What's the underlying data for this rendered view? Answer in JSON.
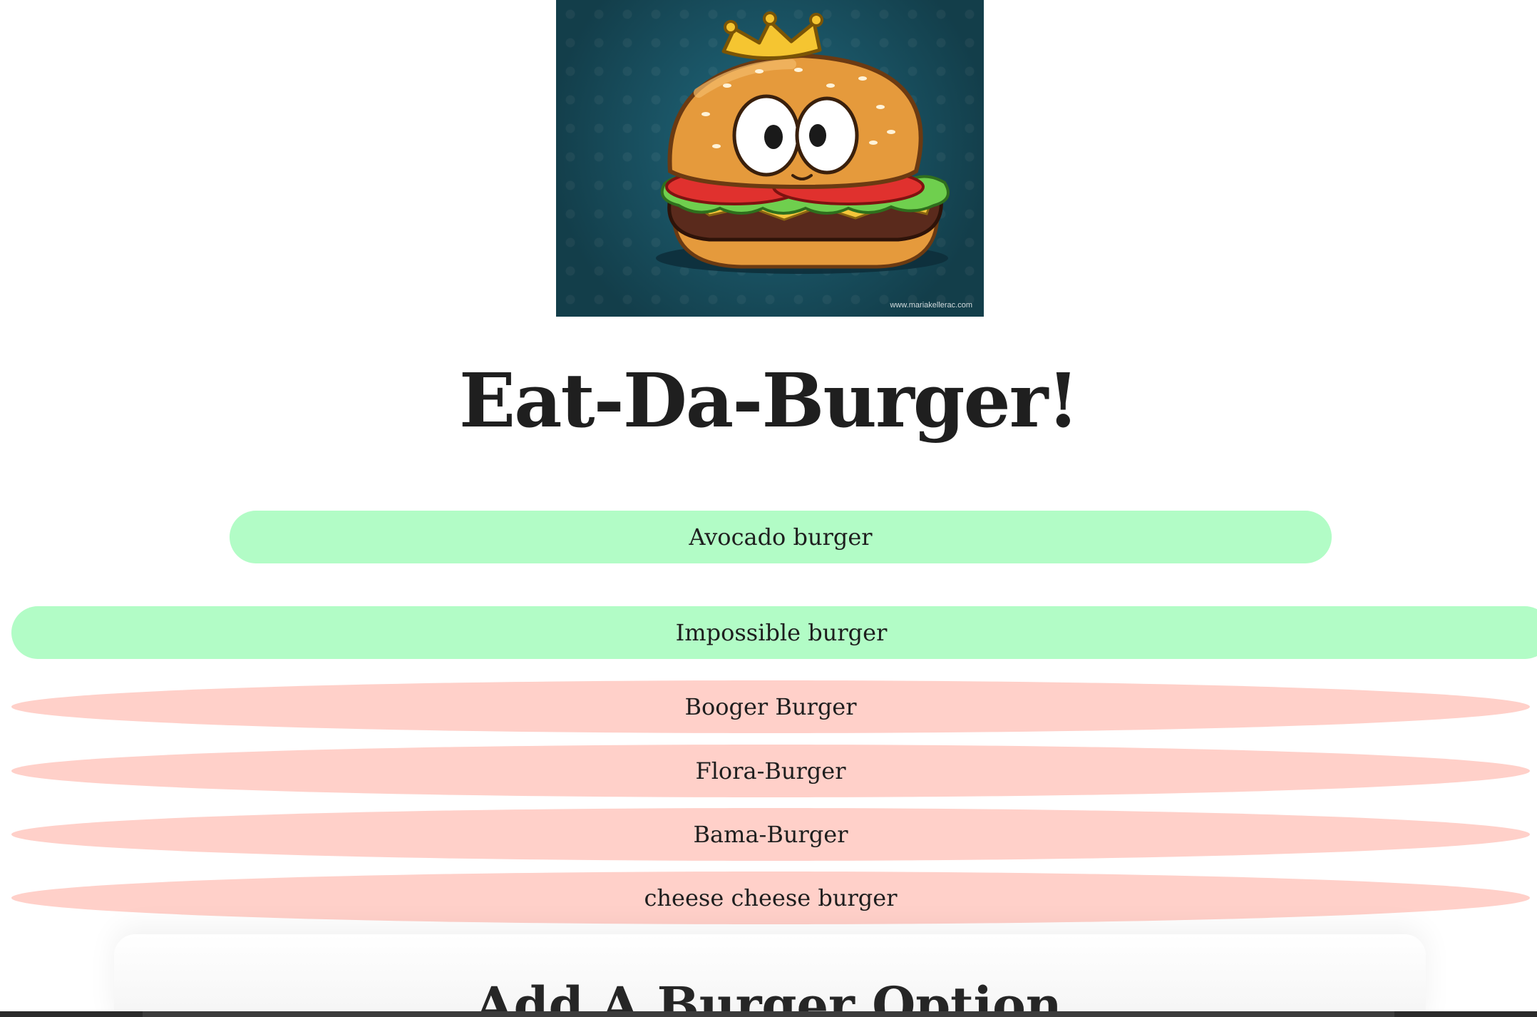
{
  "hero": {
    "image_alt": "Burger with crown mascot",
    "credit": "www.mariakellerac.com"
  },
  "page": {
    "title": "Eat-Da-Burger!"
  },
  "burgers": {
    "fresh": [
      {
        "name": "Avocado burger"
      },
      {
        "name": "Impossible burger"
      }
    ],
    "devoured": [
      {
        "name": "Booger Burger"
      },
      {
        "name": "Flora-Burger"
      },
      {
        "name": "Bama-Burger"
      },
      {
        "name": "cheese cheese burger"
      }
    ]
  },
  "add_form": {
    "heading": "Add A Burger Option"
  },
  "colors": {
    "fresh_button": "#b2fcc6",
    "devoured_button": "#ffd0c9",
    "hero_background": "#1d5f72"
  }
}
